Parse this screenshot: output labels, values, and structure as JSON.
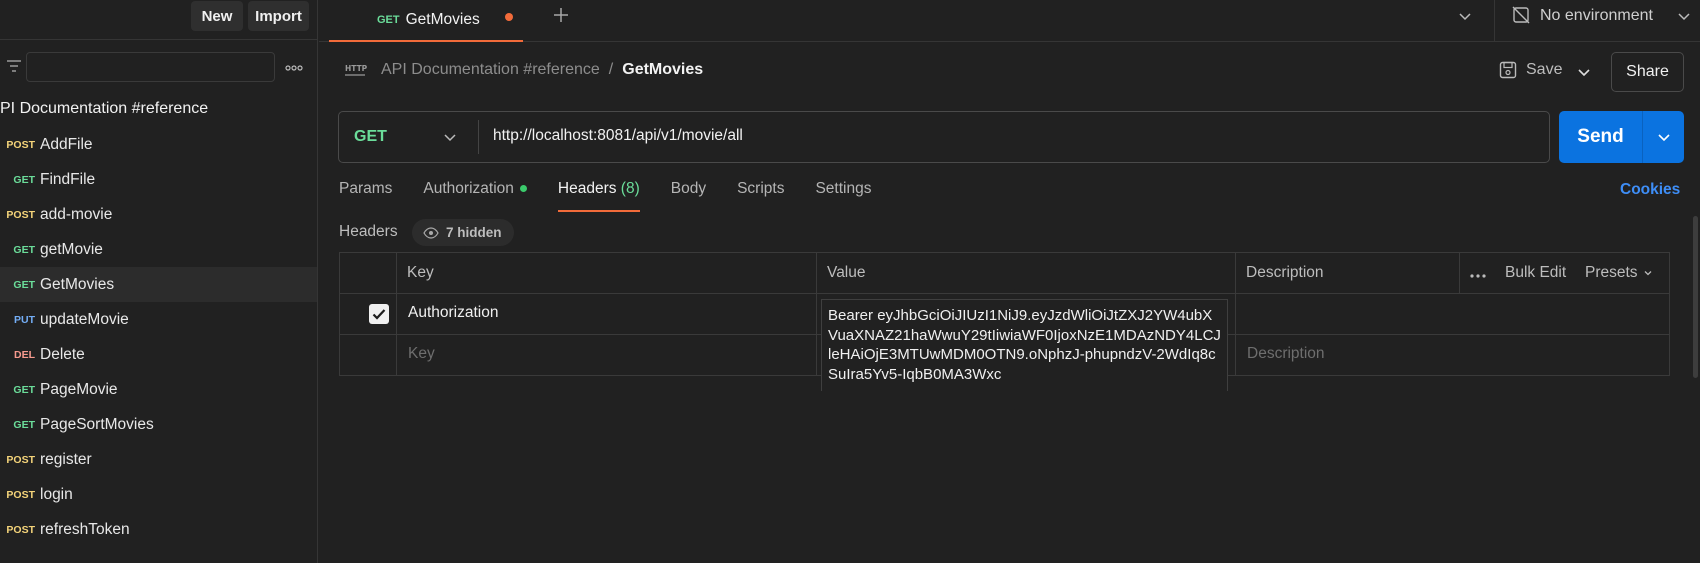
{
  "sidebar": {
    "new_label": "New",
    "import_label": "Import",
    "collection_title": "PI Documentation #reference",
    "items": [
      {
        "method": "POST",
        "name": "AddFile"
      },
      {
        "method": "GET",
        "name": "FindFile"
      },
      {
        "method": "POST",
        "name": "add-movie"
      },
      {
        "method": "GET",
        "name": "getMovie"
      },
      {
        "method": "GET",
        "name": "GetMovies"
      },
      {
        "method": "PUT",
        "name": "updateMovie"
      },
      {
        "method": "DEL",
        "name": "Delete"
      },
      {
        "method": "GET",
        "name": "PageMovie"
      },
      {
        "method": "GET",
        "name": "PageSortMovies"
      },
      {
        "method": "POST",
        "name": "register"
      },
      {
        "method": "POST",
        "name": "login"
      },
      {
        "method": "POST",
        "name": "refreshToken"
      }
    ]
  },
  "tab": {
    "method": "GET",
    "name": "GetMovies"
  },
  "environment": {
    "label": "No environment"
  },
  "breadcrumb": {
    "parent": "API Documentation #reference",
    "separator": "/",
    "current": "GetMovies"
  },
  "toolbar": {
    "save_label": "Save",
    "share_label": "Share"
  },
  "request": {
    "method": "GET",
    "url": "http://localhost:8081/api/v1/movie/all",
    "send_label": "Send"
  },
  "request_tabs": {
    "params": "Params",
    "authorization": "Authorization",
    "headers": "Headers",
    "headers_count": "(8)",
    "body": "Body",
    "scripts": "Scripts",
    "settings": "Settings",
    "cookies": "Cookies"
  },
  "headers_section": {
    "label": "Headers",
    "hidden": "7 hidden",
    "columns": {
      "key": "Key",
      "value": "Value",
      "description": "Description"
    },
    "bulk_edit": "Bulk Edit",
    "presets": "Presets",
    "rows": [
      {
        "key": "Authorization",
        "value": "Bearer eyJhbGciOiJIUzI1NiJ9.eyJzdWliOiJtZXJ2YW4ubXVuaXNAZ21haWwuY29tIiwiaWF0IjoxNzE1MDAzNDY4LCJleHAiOjE3MTUwMDM0OTN9.oNphzJ-phupndzV-2WdIq8cSuIra5Yv5-IqbB0MA3Wxc"
      }
    ],
    "placeholders": {
      "key": "Key",
      "description": "Description"
    }
  },
  "colors": {
    "accent": "#f26b3a",
    "send": "#0b73e0",
    "get": "#6bdd9a",
    "post": "#f5d47a",
    "put": "#74aef6",
    "del": "#f79a8e",
    "link": "#3e8ef7"
  }
}
